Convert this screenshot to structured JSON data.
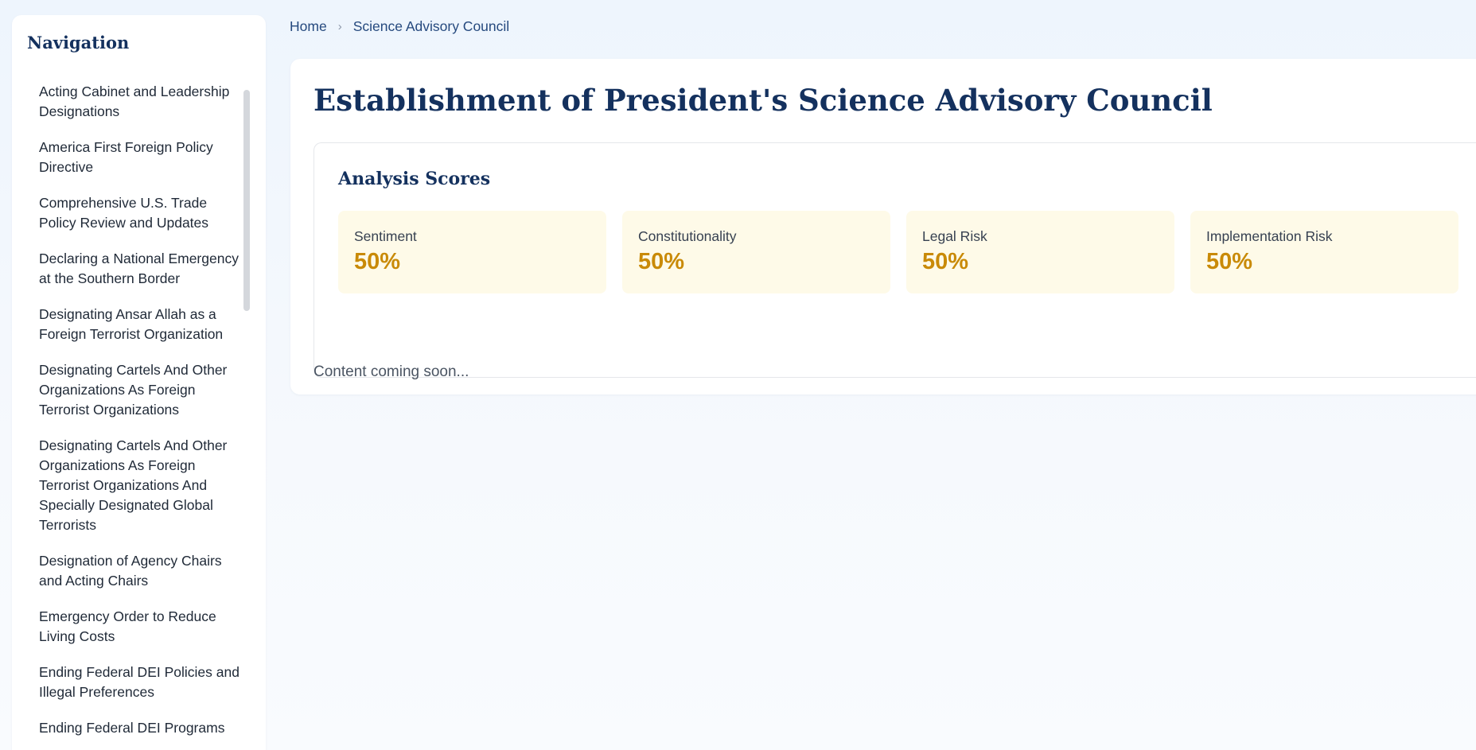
{
  "sidebar": {
    "title": "Navigation",
    "items": [
      {
        "label": "Acting Cabinet and Leadership Designations"
      },
      {
        "label": "America First Foreign Policy Directive"
      },
      {
        "label": "Comprehensive U.S. Trade Policy Review and Updates"
      },
      {
        "label": "Declaring a National Emergency at the Southern Border"
      },
      {
        "label": "Designating Ansar Allah as a Foreign Terrorist Organization"
      },
      {
        "label": "Designating Cartels And Other Organizations As Foreign Terrorist Organizations"
      },
      {
        "label": "Designating Cartels And Other Organizations As Foreign Terrorist Organizations And Specially Designated Global Terrorists"
      },
      {
        "label": "Designation of Agency Chairs and Acting Chairs"
      },
      {
        "label": "Emergency Order to Reduce Living Costs"
      },
      {
        "label": "Ending Federal DEI Policies and Illegal Preferences"
      },
      {
        "label": "Ending Federal DEI Programs"
      }
    ]
  },
  "breadcrumb": {
    "home": "Home",
    "separator": "›",
    "current": "Science Advisory Council"
  },
  "main": {
    "title": "Establishment of President's Science Advisory Council",
    "scores": {
      "heading": "Analysis Scores",
      "items": [
        {
          "label": "Sentiment",
          "value": "50%"
        },
        {
          "label": "Constitutionality",
          "value": "50%"
        },
        {
          "label": "Legal Risk",
          "value": "50%"
        },
        {
          "label": "Implementation Risk",
          "value": "50%"
        }
      ]
    },
    "note": "Content coming soon..."
  },
  "icons": {
    "breadcrumb_separator": "chevron-right-icon"
  },
  "colors": {
    "title_navy": "#14315e",
    "link_blue": "#25497e",
    "score_gold": "#c98a07",
    "score_card_bg": "#fefae8"
  }
}
